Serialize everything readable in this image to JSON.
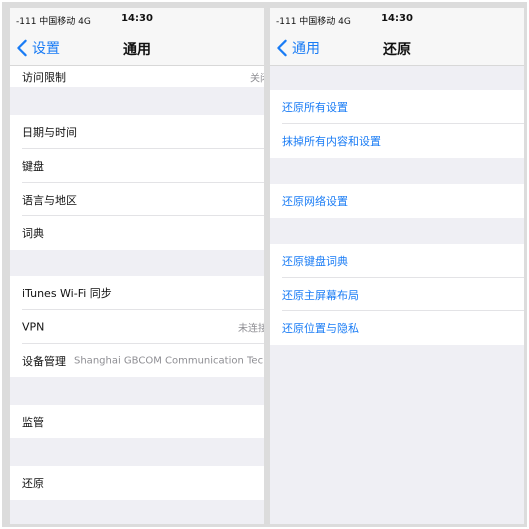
{
  "left_screen": {
    "status": {
      "carrier": "-111 中国移动  4G",
      "time": "14:30"
    },
    "nav": {
      "back_label": "设置",
      "title": "通用"
    },
    "rows": {
      "restrictions": {
        "label": "访问限制",
        "detail": "关闭"
      },
      "date_time": {
        "label": "日期与时间"
      },
      "keyboard": {
        "label": "键盘"
      },
      "language_region": {
        "label": "语言与地区"
      },
      "dictionary": {
        "label": "词典"
      },
      "itunes_wifi_sync": {
        "label": "iTunes Wi-Fi 同步"
      },
      "vpn": {
        "label": "VPN",
        "detail": "未连接"
      },
      "device_management": {
        "label": "设备管理",
        "detail": "Shanghai GBCOM Communication Tec"
      },
      "supervision": {
        "label": "监管"
      },
      "reset": {
        "label": "还原"
      }
    }
  },
  "right_screen": {
    "status": {
      "carrier": "-111 中国移动  4G",
      "time": "14:30"
    },
    "nav": {
      "back_label": "通用",
      "title": "还原"
    },
    "rows": {
      "reset_all_settings": "还原所有设置",
      "erase_all": "抹掉所有内容和设置",
      "reset_network": "还原网络设置",
      "reset_keyboard_dictionary": "还原键盘词典",
      "reset_home_layout": "还原主屏幕布局",
      "reset_location_privacy": "还原位置与隐私"
    }
  },
  "colors": {
    "accent": "#1a7cf5",
    "group_bg": "#efeff4",
    "cell_bg": "#ffffff"
  }
}
